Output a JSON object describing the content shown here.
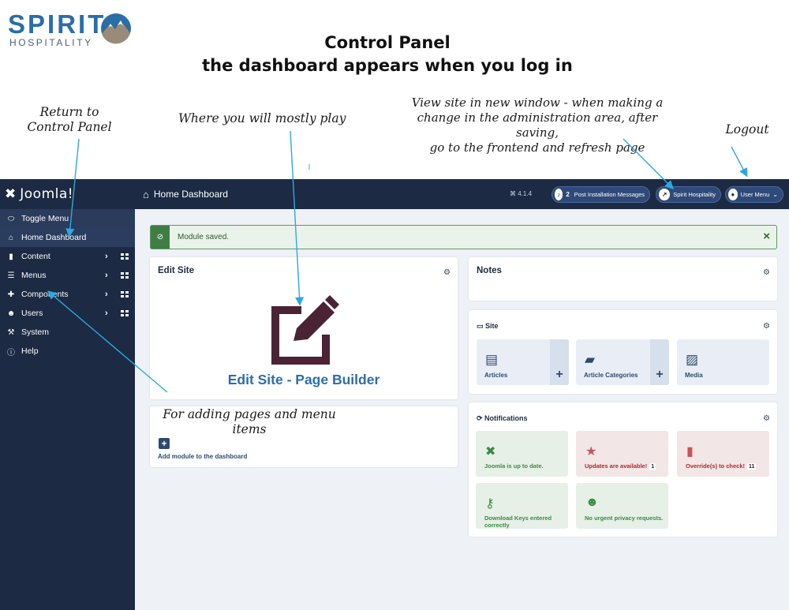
{
  "brand": {
    "name": "SPIRIT",
    "tagline": "HOSPITALITY"
  },
  "title": {
    "line1": "Control Panel",
    "line2": "the dashboard appears when you log in"
  },
  "annotations": {
    "return": "Return to\nControl Panel",
    "play": "Where you will mostly play",
    "view_site": "View site in new window - when making a\nchange in the administration area, after saving,\ngo to the frontend and refresh page",
    "logout": "Logout",
    "adding": "For adding pages and menu\nitems"
  },
  "sidebar": {
    "brand": "Joomla!",
    "items": [
      {
        "label": "Toggle Menu",
        "icon": "toggle-icon"
      },
      {
        "label": "Home Dashboard",
        "icon": "home-icon"
      },
      {
        "label": "Content",
        "icon": "file-icon",
        "submenu": true
      },
      {
        "label": "Menus",
        "icon": "list-icon",
        "submenu": true
      },
      {
        "label": "Components",
        "icon": "puzzle-icon",
        "submenu": true
      },
      {
        "label": "Users",
        "icon": "users-icon",
        "submenu": true
      },
      {
        "label": "System",
        "icon": "wrench-icon"
      },
      {
        "label": "Help",
        "icon": "info-icon"
      }
    ]
  },
  "header": {
    "title": "Home Dashboard",
    "version": "⌘ 4.1.4",
    "messages_count": "2",
    "messages_label": "Post Installation Messages",
    "site_label": "Spirit Hospitality",
    "user_label": "User Menu"
  },
  "alert": {
    "message": "Module saved.",
    "close": "×"
  },
  "edit_site": {
    "title": "Edit Site",
    "label": "Edit Site - Page Builder"
  },
  "add_module": {
    "label": "Add module to the dashboard"
  },
  "notes": {
    "title": "Notes"
  },
  "site": {
    "title": "Site",
    "tiles": [
      {
        "label": "Articles"
      },
      {
        "label": "Article Categories"
      },
      {
        "label": "Media"
      }
    ]
  },
  "notifications": {
    "title": "Notifications",
    "tiles": [
      {
        "label": "Joomla is up to date."
      },
      {
        "label": "Updates are available!",
        "badge": "1"
      },
      {
        "label": "Override(s) to check!",
        "badge": "11"
      },
      {
        "label": "Download Keys entered correctly"
      },
      {
        "label": "No urgent privacy requests."
      }
    ]
  },
  "colors": {
    "sidebar": "#1c2a43",
    "accent": "#2e6dad",
    "success": "#3a8a45",
    "danger": "#b3262e"
  }
}
